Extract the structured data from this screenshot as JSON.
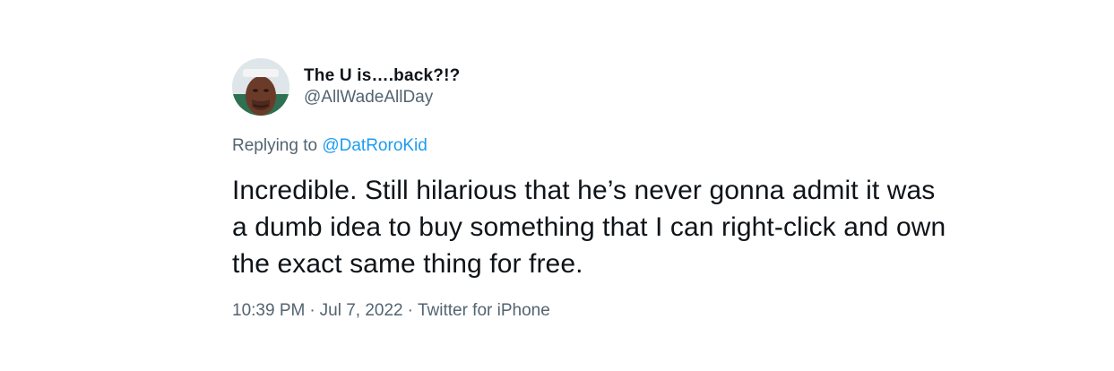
{
  "tweet": {
    "author": {
      "display_name": "The U is….back?!?",
      "handle": "@AllWadeAllDay"
    },
    "reply": {
      "prefix": "Replying to",
      "mention": "@DatRoroKid"
    },
    "text": "Incredible. Still hilarious that he’s never gonna admit it was a dumb idea to buy something that I can right-click and own the exact same thing for free.",
    "meta": {
      "time": "10:39 PM",
      "separator": "·",
      "date": "Jul 7, 2022",
      "source": "Twitter for iPhone"
    }
  },
  "colors": {
    "text_primary": "#0f1419",
    "text_secondary": "#536471",
    "link": "#1d9bf0"
  }
}
